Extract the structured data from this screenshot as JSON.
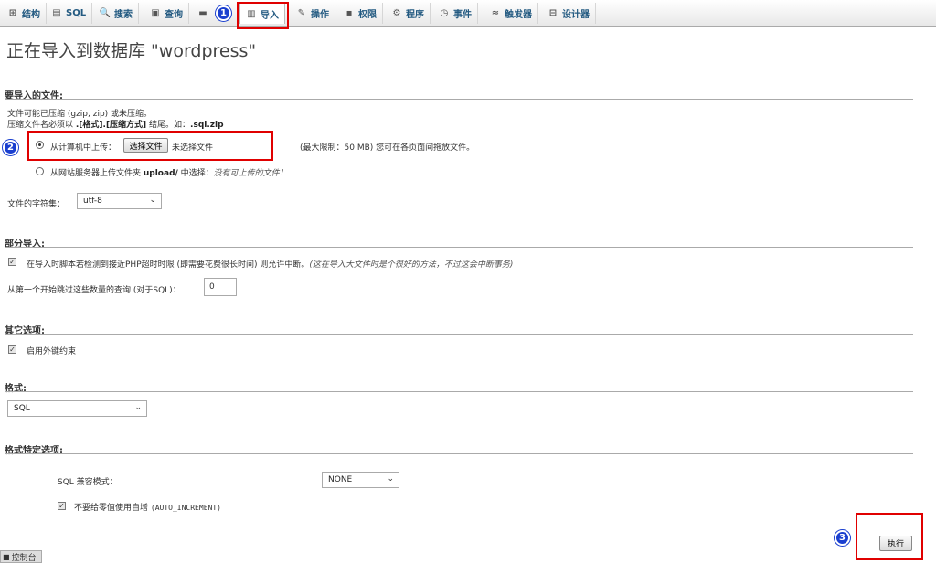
{
  "tabs": [
    {
      "label": "结构",
      "icon": "structure-icon",
      "glyph": "⊞"
    },
    {
      "label": "SQL",
      "icon": "sql-icon",
      "glyph": "▤"
    },
    {
      "label": "搜索",
      "icon": "search-icon",
      "glyph": "🔍"
    },
    {
      "label": "查询",
      "icon": "query-icon",
      "glyph": "▣"
    },
    {
      "label": "",
      "icon": "export-icon",
      "glyph": "▬"
    },
    {
      "label": "导入",
      "icon": "import-icon",
      "glyph": "▥"
    },
    {
      "label": "操作",
      "icon": "operations-icon",
      "glyph": "✎"
    },
    {
      "label": "权限",
      "icon": "privileges-icon",
      "glyph": "▪"
    },
    {
      "label": "程序",
      "icon": "routines-icon",
      "glyph": "⚙"
    },
    {
      "label": "事件",
      "icon": "events-icon",
      "glyph": "◷"
    },
    {
      "label": "触发器",
      "icon": "triggers-icon",
      "glyph": "≈"
    },
    {
      "label": "设计器",
      "icon": "designer-icon",
      "glyph": "⊟"
    }
  ],
  "annotations": [
    "1",
    "2",
    "3"
  ],
  "title": "正在导入到数据库 \"wordpress\"",
  "file_section": {
    "title": "要导入的文件:",
    "line1": "文件可能已压缩 (gzip, zip) 或未压缩。",
    "line2_a": "压缩文件名必须以 ",
    "line2_b": ".[格式].[压缩方式]",
    "line2_c": " 结尾。如：",
    "line2_d": ".sql.zip",
    "upload_label": "从计算机中上传：",
    "choose_button": "选择文件",
    "no_file": "未选择文件",
    "max_limit": "(最大限制：50 MB) 您可在各页面间拖放文件。",
    "server_label_a": "从网站服务器上传文件夹 ",
    "server_label_b": "upload/",
    "server_label_c": " 中选择：",
    "server_hint": "没有可上传的文件！",
    "charset_label": "文件的字符集：",
    "charset_value": "utf-8"
  },
  "partial_section": {
    "title": "部分导入:",
    "interrupt_label": "在导入时脚本若检测到接近PHP超时时限 (即需要花费很长时间) 则允许中断。",
    "interrupt_hint": "(这在导入大文件时是个很好的方法，不过这会中断事务)",
    "skip_label": "从第一个开始跳过这些数量的查询 (对于SQL)：",
    "skip_value": "0"
  },
  "other_section": {
    "title": "其它选项:",
    "fk_label": "启用外键约束"
  },
  "format_section": {
    "title": "格式:",
    "format_value": "SQL"
  },
  "format_options": {
    "title": "格式特定选项:",
    "compat_label": "SQL 兼容模式：",
    "compat_value": "NONE",
    "autoinc_label": "不要给零值使用自增",
    "autoinc_code": "(AUTO_INCREMENT)"
  },
  "go_button": "执行",
  "console_label": "控制台"
}
